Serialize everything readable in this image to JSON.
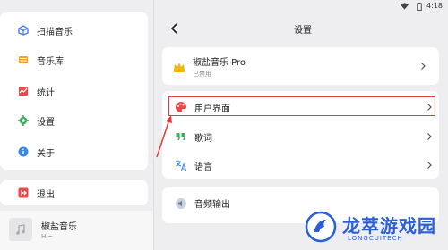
{
  "status_bar": {
    "time": "4:18"
  },
  "sidebar": {
    "items": [
      {
        "label": "扫描音乐",
        "icon": "scan-music-icon"
      },
      {
        "label": "音乐库",
        "icon": "music-library-icon"
      },
      {
        "label": "统计",
        "icon": "statistics-icon"
      },
      {
        "label": "设置",
        "icon": "settings-gear-icon"
      },
      {
        "label": "关于",
        "icon": "info-icon"
      }
    ],
    "exit": {
      "label": "退出",
      "icon": "exit-icon"
    }
  },
  "now_playing": {
    "title": "椒盐音乐",
    "subtitle": "Hi~"
  },
  "settings": {
    "title": "设置",
    "pro": {
      "label": "椒盐音乐 Pro",
      "status": "已禁用"
    },
    "rows": [
      {
        "label": "用户界面",
        "icon": "palette-icon",
        "highlighted": true
      },
      {
        "label": "歌词",
        "icon": "quote-icon"
      },
      {
        "label": "语言",
        "icon": "translate-icon"
      }
    ],
    "audio_output": {
      "label": "音频输出",
      "icon": "speaker-icon"
    }
  },
  "colors": {
    "accent_highlight": "#e23a3a",
    "watermark_blue": "#2a5fd6"
  },
  "watermark": {
    "title": "龙萃游戏园",
    "subtitle": "LONGCUITECH"
  }
}
